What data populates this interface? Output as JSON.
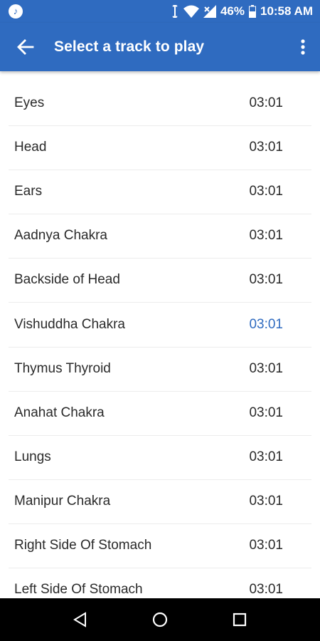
{
  "status_bar": {
    "battery": "46%",
    "time": "10:58 AM"
  },
  "app_bar": {
    "title": "Select a track to play"
  },
  "tracks": [
    {
      "name": "Eyes",
      "duration": "03:01"
    },
    {
      "name": "Head",
      "duration": "03:01"
    },
    {
      "name": "Ears",
      "duration": "03:01"
    },
    {
      "name": "Aadnya Chakra",
      "duration": "03:01"
    },
    {
      "name": "Backside of Head",
      "duration": "03:01"
    },
    {
      "name": "Vishuddha Chakra",
      "duration": "03:01"
    },
    {
      "name": "Thymus Thyroid",
      "duration": "03:01"
    },
    {
      "name": "Anahat Chakra",
      "duration": "03:01"
    },
    {
      "name": "Lungs",
      "duration": "03:01"
    },
    {
      "name": "Manipur Chakra",
      "duration": "03:01"
    },
    {
      "name": "Right Side Of Stomach",
      "duration": "03:01"
    },
    {
      "name": "Left Side Of Stomach",
      "duration": "03:01"
    }
  ],
  "active_track_index": 5,
  "colors": {
    "primary": "#2f6bc0",
    "text": "#2a2a2a",
    "divider": "#ececec",
    "nav_bar": "#000000"
  }
}
